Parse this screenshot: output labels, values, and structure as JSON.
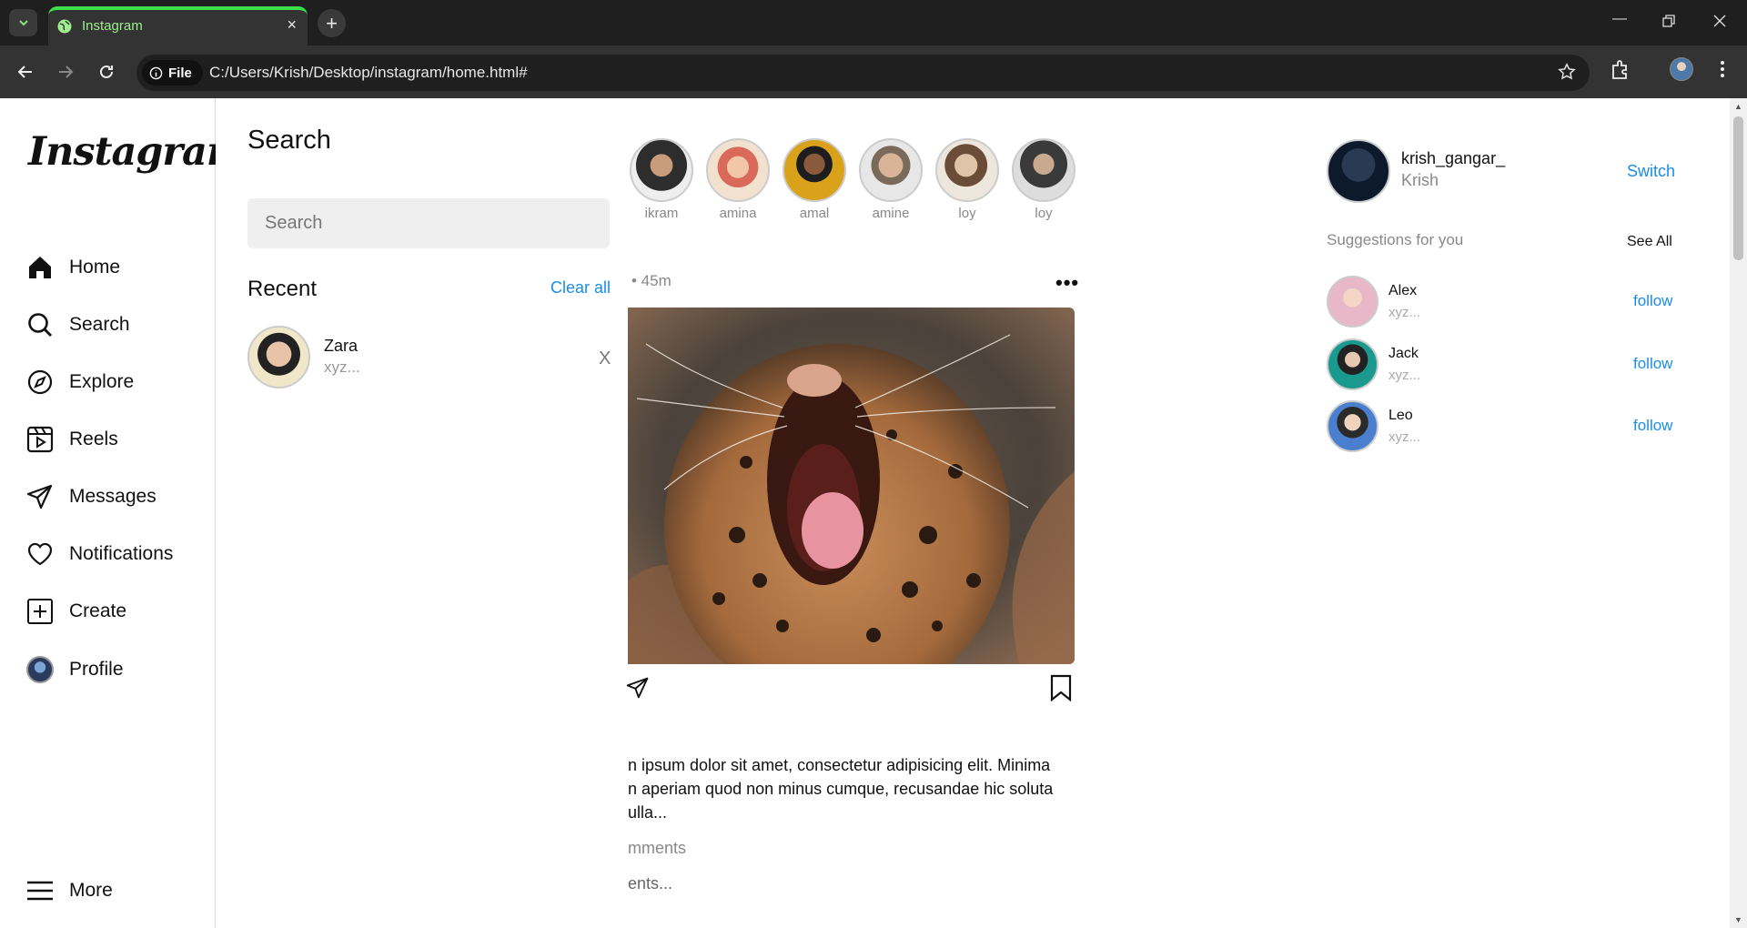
{
  "browser": {
    "tab_title": "Instagram",
    "tab_close": "×",
    "new_tab": "+",
    "chip_label": "File",
    "url": "C:/Users/Krish/Desktop/instagram/home.html#"
  },
  "sidebar": {
    "logo": "Instagram",
    "items": [
      {
        "label": "Home",
        "icon": "home-icon"
      },
      {
        "label": "Search",
        "icon": "search-icon"
      },
      {
        "label": "Explore",
        "icon": "compass-icon"
      },
      {
        "label": "Reels",
        "icon": "reels-icon"
      },
      {
        "label": "Messages",
        "icon": "send-icon"
      },
      {
        "label": "Notifications",
        "icon": "heart-icon"
      },
      {
        "label": "Create",
        "icon": "plus-square-icon"
      },
      {
        "label": "Profile",
        "icon": "profile-avatar"
      }
    ],
    "more": "More"
  },
  "search_panel": {
    "title": "Search",
    "placeholder": "Search",
    "recent_heading": "Recent",
    "clear_all": "Clear all",
    "recent": {
      "name": "Zara",
      "sub": "xyz...",
      "remove": "X"
    }
  },
  "stories": [
    {
      "name": "ikram",
      "color": "#3a3a3a"
    },
    {
      "name": "amina",
      "color": "#d96a5a"
    },
    {
      "name": "amal",
      "color": "#d9a21a"
    },
    {
      "name": "amine",
      "color": "#c9c9c9"
    },
    {
      "name": "loy",
      "color": "#b09a82"
    },
    {
      "name": "loy",
      "color": "#6b6b6b"
    }
  ],
  "post": {
    "time": "• 45m",
    "more": "•••",
    "caption": "n ipsum dolor sit amet, consectetur adipisicing elit. Minima\nn aperiam quod non minus cumque, recusandae hic soluta\nulla...",
    "comments_view": "mments",
    "comments_add": "ents..."
  },
  "me": {
    "username": "krish_gangar_",
    "name": "Krish",
    "switch": "Switch"
  },
  "suggestions": {
    "heading": "Suggestions for you",
    "see_all": "See All",
    "items": [
      {
        "name": "Alex",
        "sub": "xyz...",
        "action": "follow",
        "color": "#e9b8c8"
      },
      {
        "name": "Jack",
        "sub": "xyz...",
        "action": "follow",
        "color": "#1a9a8e"
      },
      {
        "name": "Leo",
        "sub": "xyz...",
        "action": "follow",
        "color": "#4a7fd0"
      }
    ]
  },
  "colors": {
    "accent": "#1a8de8",
    "tab_indicator": "#3ddc4c"
  }
}
